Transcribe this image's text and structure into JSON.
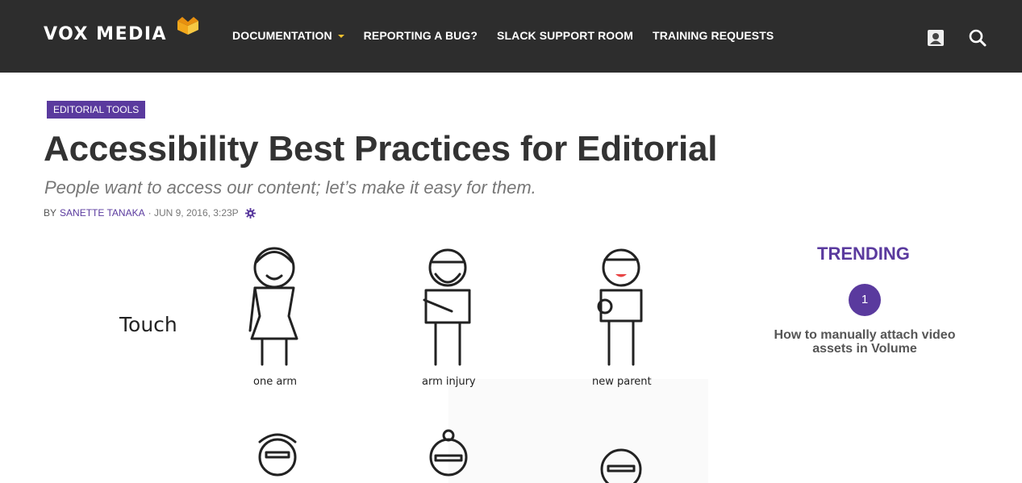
{
  "header": {
    "logo_text": "VOX MEDIA",
    "nav": [
      {
        "label": "DOCUMENTATION",
        "has_dropdown": true
      },
      {
        "label": "REPORTING A BUG?"
      },
      {
        "label": "SLACK SUPPORT ROOM"
      },
      {
        "label": "TRAINING REQUESTS"
      }
    ],
    "icons": [
      "user-icon",
      "search-icon"
    ]
  },
  "article": {
    "category": "EDITORIAL TOOLS",
    "title": "Accessibility Best Practices for Editorial",
    "dek": "People want to access our content; let’s make it easy for them.",
    "byline_prefix": "BY",
    "author": "SANETTE TANAKA",
    "date": "· JUN 9, 2016, 3:23P",
    "illustration": {
      "row_label": "Touch",
      "figures": [
        "one arm",
        "arm injury",
        "new parent"
      ]
    }
  },
  "sidebar": {
    "trending_title": "TRENDING",
    "items": [
      {
        "rank": "1",
        "title": "How to manually attach video assets in Volume"
      }
    ]
  },
  "colors": {
    "header_bg": "#2d2d2d",
    "accent": "#5a3a9e",
    "logo_mark": "#f2a71b"
  }
}
